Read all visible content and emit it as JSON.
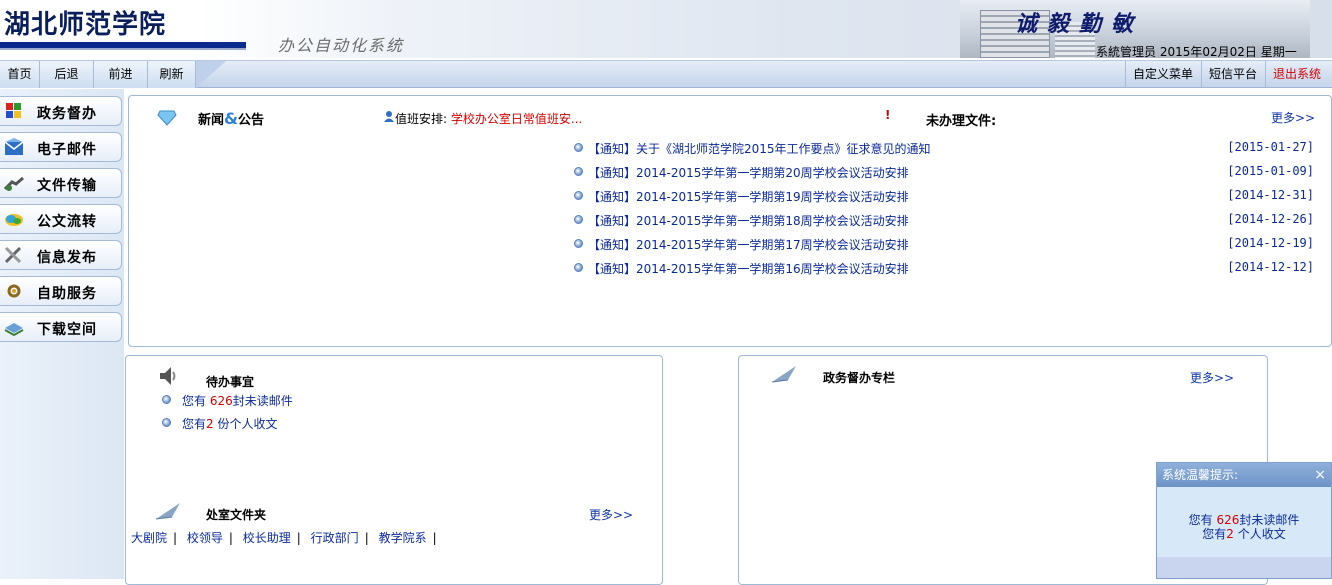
{
  "header": {
    "logo": "湖北师范学院",
    "subtitle": "办公自动化系统",
    "motto": "诚毅勤敏",
    "user": "系統管理员",
    "date": "2015年02月02日",
    "weekday": "星期一"
  },
  "nav": {
    "home": "首页",
    "back": "后退",
    "forward": "前进",
    "refresh": "刷新",
    "custom_menu": "自定义菜单",
    "sms": "短信平台",
    "logout": "退出系统"
  },
  "sidebar": {
    "items": [
      {
        "label": "政务督办",
        "icon": "supervision-icon"
      },
      {
        "label": "电子邮件",
        "icon": "mail-icon"
      },
      {
        "label": "文件传输",
        "icon": "file-transfer-icon"
      },
      {
        "label": "公文流转",
        "icon": "document-flow-icon"
      },
      {
        "label": "信息发布",
        "icon": "tools-icon"
      },
      {
        "label": "自助服务",
        "icon": "self-service-icon"
      },
      {
        "label": "下载空间",
        "icon": "download-icon"
      }
    ]
  },
  "news": {
    "title_a": "新闻",
    "amp": "&",
    "title_b": "公告",
    "duty_label": "值班安排:",
    "duty_text": "学校办公室日常值班安...",
    "alert": "!"
  },
  "pending_docs": {
    "title": "未办理文件:",
    "more": "更多>>",
    "items": [
      {
        "title": "【通知】关于《湖北师范学院2015年工作要点》征求意见的通知",
        "date": "[2015-01-27]"
      },
      {
        "title": "【通知】2014-2015学年第一学期第20周学校会议活动安排",
        "date": "[2015-01-09]"
      },
      {
        "title": "【通知】2014-2015学年第一学期第19周学校会议活动安排",
        "date": "[2014-12-31]"
      },
      {
        "title": "【通知】2014-2015学年第一学期第18周学校会议活动安排",
        "date": "[2014-12-26]"
      },
      {
        "title": "【通知】2014-2015学年第一学期第17周学校会议活动安排",
        "date": "[2014-12-19]"
      },
      {
        "title": "【通知】2014-2015学年第一学期第16周学校会议活动安排",
        "date": "[2014-12-12]"
      }
    ]
  },
  "todo": {
    "title": "待办事宜",
    "mail_prefix": "您有",
    "mail_count": "626",
    "mail_suffix": "封未读邮件",
    "docs_prefix": "您有",
    "docs_count": "2",
    "docs_suffix": "份个人收文"
  },
  "folders": {
    "title": "处室文件夹",
    "more": "更多>>",
    "links": [
      "大剧院",
      "校领导",
      "校长助理",
      "行政部门",
      "教学院系"
    ],
    "sep": "|"
  },
  "supervision": {
    "title": "政务督办专栏",
    "more": "更多>>"
  },
  "popup": {
    "title": "系统温馨提示:",
    "close": "×",
    "mail_prefix": "您有",
    "mail_count": "626",
    "mail_suffix": "封未读邮件",
    "docs_prefix": "您有",
    "docs_count": "2",
    "docs_suffix": "个人收文"
  }
}
